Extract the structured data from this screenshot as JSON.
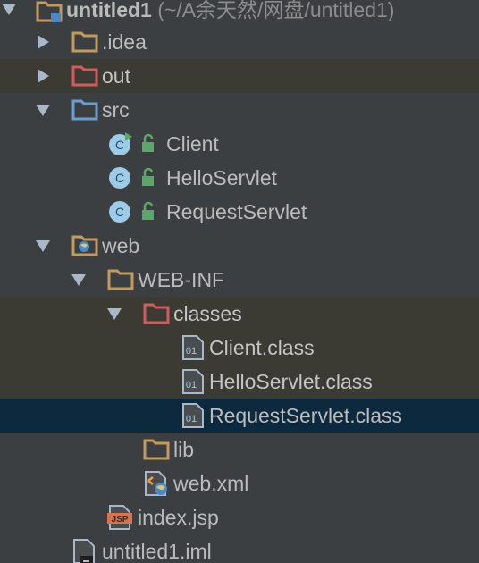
{
  "project": {
    "name": "untitled1",
    "path": "(~/A余天然/网盘/untitled1)"
  },
  "nodes": [
    {
      "label": ".idea"
    },
    {
      "label": "out"
    },
    {
      "label": "src"
    },
    {
      "label": "Client"
    },
    {
      "label": "HelloServlet"
    },
    {
      "label": "RequestServlet"
    },
    {
      "label": "web"
    },
    {
      "label": "WEB-INF"
    },
    {
      "label": "classes"
    },
    {
      "label": "Client.class"
    },
    {
      "label": "HelloServlet.class"
    },
    {
      "label": "RequestServlet.class"
    },
    {
      "label": "lib"
    },
    {
      "label": "web.xml"
    },
    {
      "label": "index.jsp"
    },
    {
      "label": "untitled1.iml"
    }
  ],
  "icon_badges": {
    "class_letter": "C",
    "compiled_letters": "01",
    "jsp_badge": "JSP"
  },
  "colors": {
    "background": "#3c3f41",
    "selection": "#0d293e",
    "excluded_row": "#3b3a33",
    "folder": "#c49a5a",
    "excluded_folder": "#d45b5b",
    "source_folder": "#6a9fd0",
    "class_icon": "#9ccce8",
    "lock": "#59a869"
  }
}
